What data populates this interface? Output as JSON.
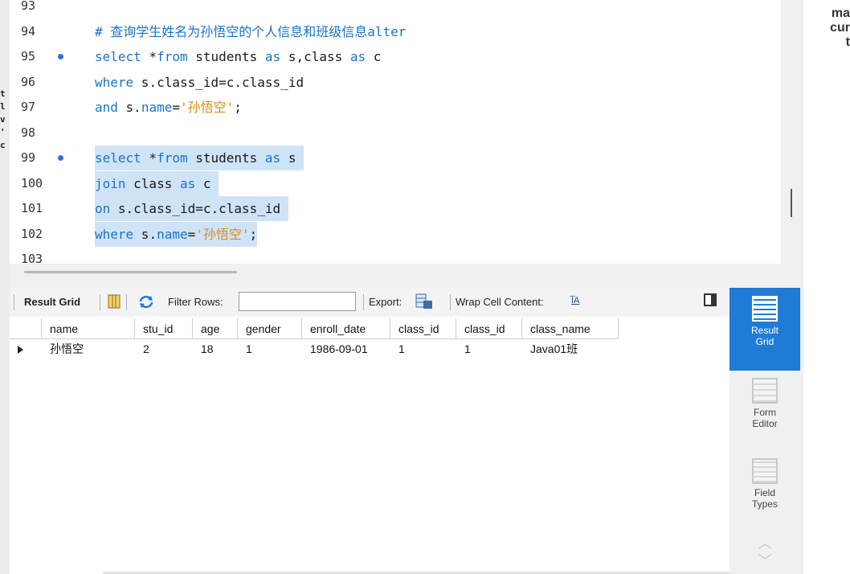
{
  "editor": {
    "lines": [
      {
        "num": "93",
        "dot": false,
        "hl": false,
        "tokens": []
      },
      {
        "num": "94",
        "dot": false,
        "hl": false,
        "tokens": [
          {
            "t": "# 查询学生姓名为孙悟空的个人信息和班级信息alter",
            "c": "cm"
          }
        ]
      },
      {
        "num": "95",
        "dot": true,
        "hl": false,
        "tokens": [
          {
            "t": "select",
            "c": "kw"
          },
          {
            "t": " *",
            "c": "id"
          },
          {
            "t": "from",
            "c": "kw"
          },
          {
            "t": " students ",
            "c": "id"
          },
          {
            "t": "as",
            "c": "kw"
          },
          {
            "t": " s,class ",
            "c": "id"
          },
          {
            "t": "as",
            "c": "kw"
          },
          {
            "t": " c",
            "c": "id"
          }
        ]
      },
      {
        "num": "96",
        "dot": false,
        "hl": false,
        "tokens": [
          {
            "t": "where",
            "c": "kw"
          },
          {
            "t": " s.class_id=c.class_id",
            "c": "id"
          }
        ]
      },
      {
        "num": "97",
        "dot": false,
        "hl": false,
        "tokens": [
          {
            "t": "and",
            "c": "kw"
          },
          {
            "t": " s.",
            "c": "id"
          },
          {
            "t": "name",
            "c": "kw"
          },
          {
            "t": "=",
            "c": "id"
          },
          {
            "t": "'孙悟空'",
            "c": "str"
          },
          {
            "t": ";",
            "c": "id"
          }
        ]
      },
      {
        "num": "98",
        "dot": false,
        "hl": false,
        "tokens": []
      },
      {
        "num": "99",
        "dot": true,
        "hl": true,
        "tokens": [
          {
            "t": "select",
            "c": "kw"
          },
          {
            "t": " *",
            "c": "id"
          },
          {
            "t": "from",
            "c": "kw"
          },
          {
            "t": " students ",
            "c": "id"
          },
          {
            "t": "as",
            "c": "kw"
          },
          {
            "t": " s ",
            "c": "id"
          }
        ]
      },
      {
        "num": "100",
        "dot": false,
        "hl": true,
        "tokens": [
          {
            "t": "join",
            "c": "kw"
          },
          {
            "t": " class ",
            "c": "id"
          },
          {
            "t": "as",
            "c": "kw"
          },
          {
            "t": " c ",
            "c": "id"
          }
        ]
      },
      {
        "num": "101",
        "dot": false,
        "hl": true,
        "tokens": [
          {
            "t": "on",
            "c": "kw"
          },
          {
            "t": " s.class_id=c.class_id ",
            "c": "id"
          }
        ]
      },
      {
        "num": "102",
        "dot": false,
        "hl": true,
        "tokens": [
          {
            "t": "where",
            "c": "kw"
          },
          {
            "t": " s.",
            "c": "id"
          },
          {
            "t": "name",
            "c": "kw"
          },
          {
            "t": "=",
            "c": "id"
          },
          {
            "t": "'孙悟空'",
            "c": "str"
          },
          {
            "t": ";",
            "c": "id"
          }
        ]
      },
      {
        "num": "103",
        "dot": false,
        "hl": false,
        "tokens": []
      }
    ]
  },
  "toolbar": {
    "result_grid": "Result Grid",
    "filter_rows": "Filter Rows:",
    "filter_value": "",
    "export": "Export:",
    "wrap_cell": "Wrap Cell Content:",
    "wrap_icon": "I̅A"
  },
  "grid": {
    "columns": [
      "name",
      "stu_id",
      "age",
      "gender",
      "enroll_date",
      "class_id",
      "class_id",
      "class_name"
    ],
    "rows": [
      [
        "孙悟空",
        "2",
        "18",
        "1",
        "1986-09-01",
        "1",
        "1",
        "Java01班"
      ]
    ]
  },
  "sidebar": {
    "result_grid": "Result\nGrid",
    "form_editor": "Form\nEditor",
    "field_types": "Field\nTypes"
  },
  "right_peek": {
    "line1": "ma",
    "line2": "cur",
    "line3": "t"
  },
  "icons": {
    "breakpoint": "breakpoint-dot-icon",
    "row_marker": "row-pointer-icon",
    "refresh": "refresh-icon",
    "export": "export-icon",
    "wrap": "wrap-text-icon",
    "columns": "columns-icon",
    "panel_toggle": "panel-toggle-icon"
  },
  "colors": {
    "keyword": "#1a73c6",
    "string": "#d88a1c",
    "selection": "#cfe3f7",
    "sidebar_active": "#1f7bd6"
  }
}
